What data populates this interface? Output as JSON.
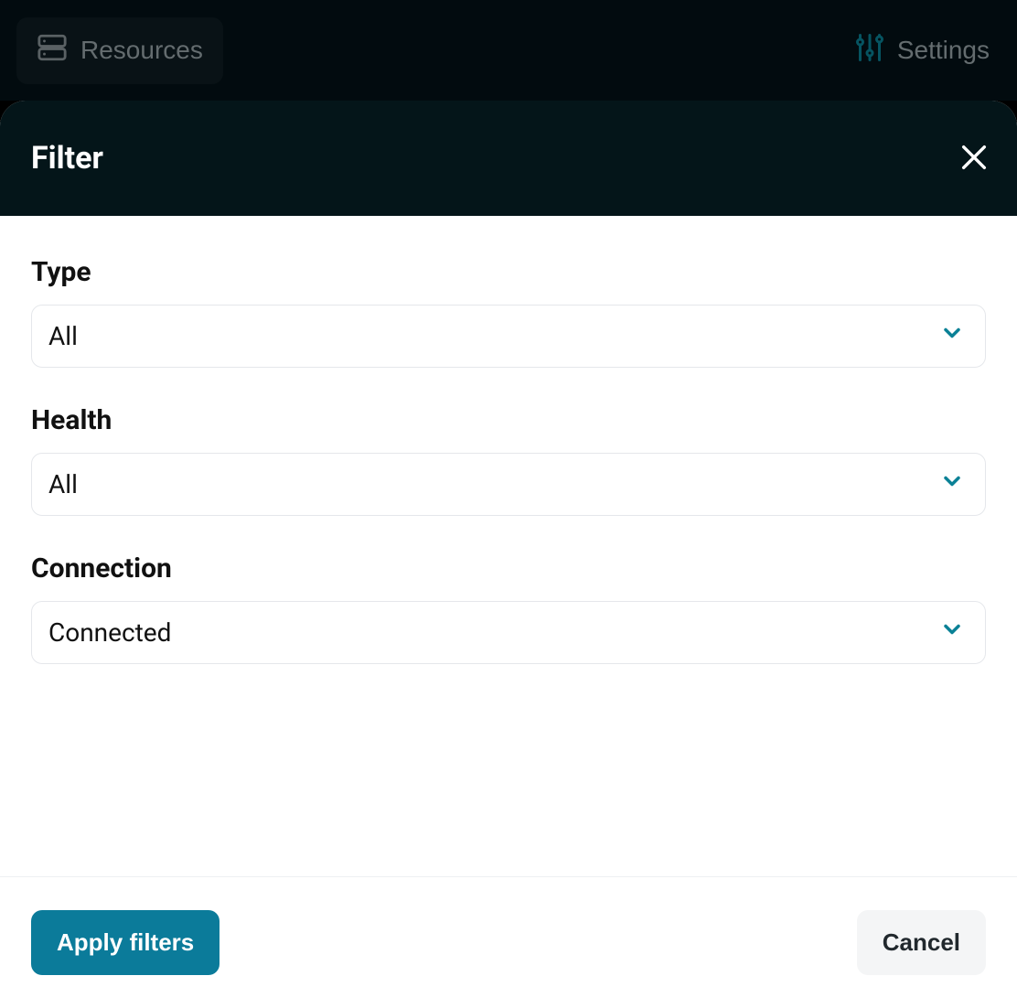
{
  "colors": {
    "accent": "#0b7b9a",
    "chevron": "#0a8196"
  },
  "topbar": {
    "resources_label": "Resources",
    "settings_label": "Settings"
  },
  "modal": {
    "title": "Filter",
    "fields": {
      "type": {
        "label": "Type",
        "value": "All"
      },
      "health": {
        "label": "Health",
        "value": "All"
      },
      "connection": {
        "label": "Connection",
        "value": "Connected"
      }
    },
    "apply_label": "Apply filters",
    "cancel_label": "Cancel"
  }
}
